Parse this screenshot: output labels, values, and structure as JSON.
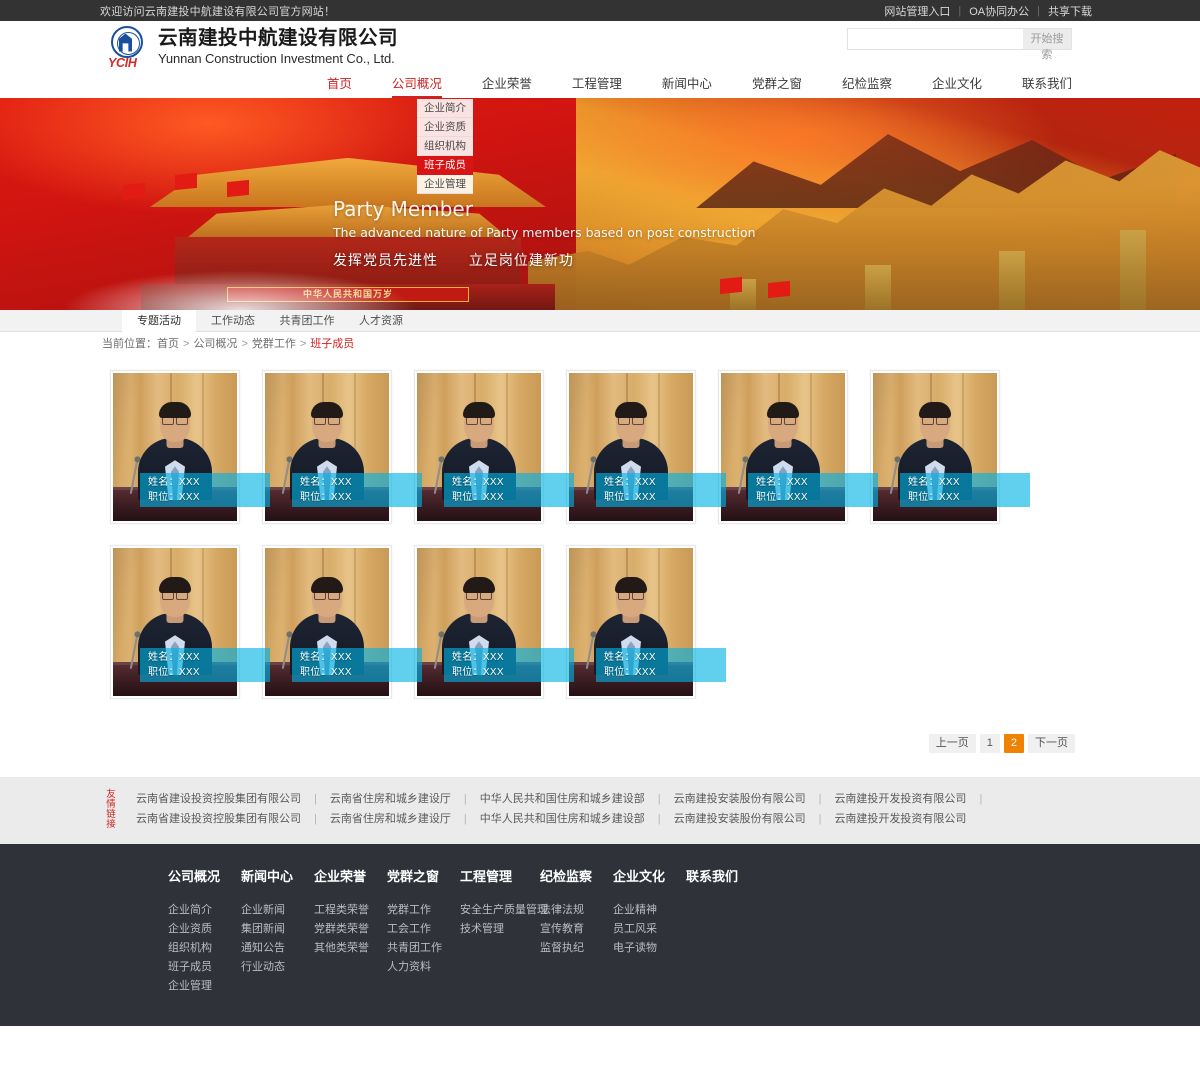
{
  "topbar": {
    "welcome": "欢迎访问云南建投中航建设有限公司官方网站！",
    "links": [
      "网站管理入口",
      "OA协同办公",
      "共享下载"
    ],
    "separator": "|"
  },
  "header": {
    "logo_cn": "云南建投中航建设有限公司",
    "logo_en": "Yunnan Construction Investment Co., Ltd.",
    "logo_abbr": "YCIH",
    "search": {
      "value": "",
      "placeholder": "",
      "button_label": "开始搜索"
    }
  },
  "nav": {
    "items": [
      {
        "label": "首页",
        "state": "home"
      },
      {
        "label": "公司概况",
        "state": "active"
      },
      {
        "label": "企业荣誉",
        "state": ""
      },
      {
        "label": "工程管理",
        "state": ""
      },
      {
        "label": "新闻中心",
        "state": ""
      },
      {
        "label": "党群之窗",
        "state": ""
      },
      {
        "label": "纪检监察",
        "state": ""
      },
      {
        "label": "企业文化",
        "state": ""
      },
      {
        "label": "联系我们",
        "state": ""
      }
    ]
  },
  "dropdown": {
    "items": [
      {
        "label": "企业简介",
        "active": false
      },
      {
        "label": "企业资质",
        "active": false
      },
      {
        "label": "组织机构",
        "active": false
      },
      {
        "label": "班子成员",
        "active": true
      },
      {
        "label": "企业管理",
        "active": false
      }
    ]
  },
  "banner": {
    "en_title": "Party Member",
    "en_sub": "The advanced nature of Party members based on post construction",
    "cn_left": "发挥党员先进性",
    "cn_right": "立足岗位建新功",
    "gate_banner": "中华人民共和国万岁"
  },
  "tabs": [
    {
      "label": "专题活动",
      "active": true
    },
    {
      "label": "工作动态",
      "active": false
    },
    {
      "label": "共青团工作",
      "active": false
    },
    {
      "label": "人才资源",
      "active": false
    }
  ],
  "breadcrumb": {
    "prefix": "当前位置：",
    "items": [
      "首页",
      "公司概况",
      "党群工作"
    ],
    "current": "班子成员",
    "separator": ">"
  },
  "members": [
    {
      "name_label": "姓名：XXX",
      "title_label": "职位：XXX"
    },
    {
      "name_label": "姓名：XXX",
      "title_label": "职位：XXX"
    },
    {
      "name_label": "姓名：XXX",
      "title_label": "职位：XXX"
    },
    {
      "name_label": "姓名：XXX",
      "title_label": "职位：XXX"
    },
    {
      "name_label": "姓名：XXX",
      "title_label": "职位：XXX"
    },
    {
      "name_label": "姓名：XXX",
      "title_label": "职位：XXX"
    },
    {
      "name_label": "姓名：XXX",
      "title_label": "职位：XXX"
    },
    {
      "name_label": "姓名：XXX",
      "title_label": "职位：XXX"
    },
    {
      "name_label": "姓名：XXX",
      "title_label": "职位：XXX"
    },
    {
      "name_label": "姓名：XXX",
      "title_label": "职位：XXX"
    }
  ],
  "pagination": {
    "prev": "上一页",
    "next": "下一页",
    "pages": [
      {
        "label": "1",
        "active": false
      },
      {
        "label": "2",
        "active": true
      }
    ]
  },
  "friend_links": {
    "title": "友情链接",
    "items": [
      "云南省建设投资控股集团有限公司",
      "云南省住房和城乡建设厅",
      "中华人民共和国住房和城乡建设部",
      "云南建投安装股份有限公司",
      "云南建投开发投资有限公司",
      "云南省建设投资控股集团有限公司",
      "云南省住房和城乡建设厅",
      "中华人民共和国住房和城乡建设部",
      "云南建投安装股份有限公司",
      "云南建投开发投资有限公司"
    ],
    "separator": "|"
  },
  "footer": {
    "columns": [
      {
        "title": "公司概况",
        "links": [
          "企业简介",
          "企业资质",
          "组织机构",
          "班子成员",
          "企业管理"
        ]
      },
      {
        "title": "新闻中心",
        "links": [
          "企业新闻",
          "集团新闻",
          "通知公告",
          "行业动态"
        ]
      },
      {
        "title": "企业荣誉",
        "links": [
          "工程类荣誉",
          "党群类荣誉",
          "其他类荣誉"
        ]
      },
      {
        "title": "党群之窗",
        "links": [
          "党群工作",
          "工会工作",
          "共青团工作",
          "人力资料"
        ]
      },
      {
        "title": "工程管理",
        "links": [
          "安全生产质量管理",
          "技术管理"
        ]
      },
      {
        "title": "纪检监察",
        "links": [
          "法律法规",
          "宣传教育",
          "监督执纪"
        ]
      },
      {
        "title": "企业文化",
        "links": [
          "企业精神",
          "员工风采",
          "电子读物"
        ]
      },
      {
        "title": "联系我们",
        "links": []
      }
    ]
  },
  "colors": {
    "brand_red": "#cf2222",
    "logo_blue": "#1a4fa0",
    "accent_orange": "#ef8200",
    "label_cyan": "#00b2e3",
    "footer_bg": "#2f3339",
    "topbar_bg": "#333333"
  }
}
